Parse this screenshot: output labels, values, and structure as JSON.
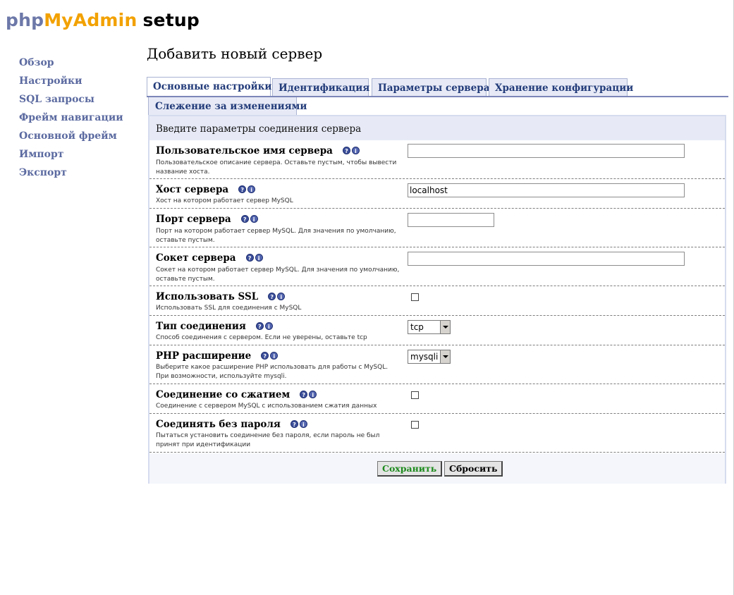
{
  "logo": {
    "part1": "php",
    "part2": "MyAdmin",
    "part3": "setup"
  },
  "menu": [
    "Обзор",
    "Настройки",
    "SQL запросы",
    "Фрейм навигации",
    "Основной фрейм",
    "Импорт",
    "Экспорт"
  ],
  "page_title": "Добавить новый сервер",
  "tabs": [
    "Основные настройки",
    "Идентификация",
    "Параметры сервера",
    "Хранение конфигурации"
  ],
  "tab_second_row": "Слежение за изменениями",
  "legend": "Введите параметры соединения сервера",
  "fields": [
    {
      "label": "Пользовательское имя сервера",
      "desc": "Пользовательское описание сервера. Оставьте пустым, чтобы вывести название хоста.",
      "value": ""
    },
    {
      "label": "Хост сервера",
      "desc": "Хост на котором работает сервер MySQL",
      "value": "localhost"
    },
    {
      "label": "Порт сервера",
      "desc": "Порт на котором работает сервер MySQL. Для значения по умолчанию, оставьте пустым.",
      "value": ""
    },
    {
      "label": "Сокет сервера",
      "desc": "Сокет на котором работает сервер MySQL. Для значения по умолчанию, оставьте пустым.",
      "value": ""
    },
    {
      "label": "Использовать SSL",
      "desc": "Использовать SSL для соединения с MySQL",
      "checked": false
    },
    {
      "label": "Тип соединения",
      "desc": "Способ соединения с сервером. Если не уверены, оставьте tcp",
      "value": "tcp"
    },
    {
      "label": "PHP расширение",
      "desc": "Выберите какое расширение PHP использовать для работы с MySQL. При возможности, используйте mysqli.",
      "value": "mysqli"
    },
    {
      "label": "Соединение со сжатием",
      "desc": "Соединение с сервером MySQL с использованием сжатия данных",
      "checked": false
    },
    {
      "label": "Соединять без пароля",
      "desc": "Пытаться установить соединение без пароля, если пароль не был принят при идентификации",
      "checked": false
    }
  ],
  "help": {
    "doc": "?",
    "info": "i"
  },
  "buttons": {
    "save": "Сохранить",
    "reset": "Сбросить"
  }
}
